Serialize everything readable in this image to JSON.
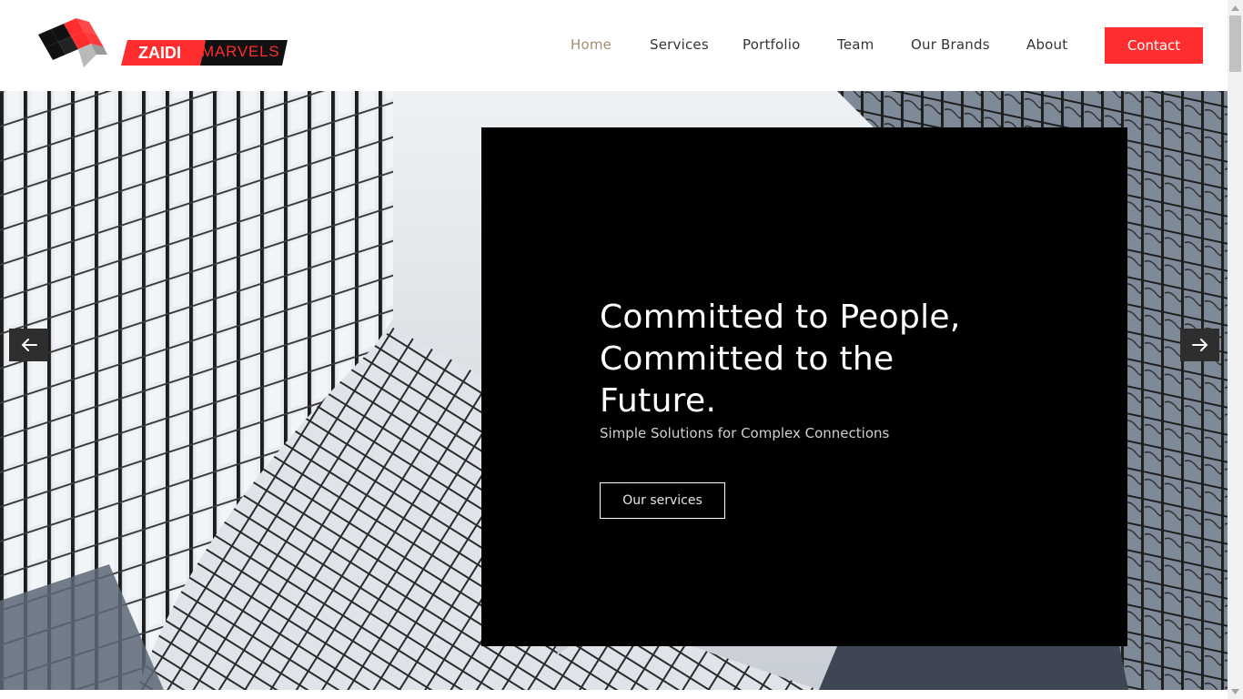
{
  "brand": {
    "name_part1": "ZAIDI",
    "name_part2": "MARVELS",
    "accent_color": "#ff2d2d"
  },
  "nav": {
    "items": [
      {
        "label": "Home",
        "active": true
      },
      {
        "label": "Services",
        "active": false
      },
      {
        "label": "Portfolio",
        "active": false
      },
      {
        "label": "Team",
        "active": false
      },
      {
        "label": "Our Brands",
        "active": false
      },
      {
        "label": "About",
        "active": false
      }
    ],
    "contact_label": "Contact"
  },
  "hero": {
    "headline": "Committed to People, Committed to the Future.",
    "subline": "Simple Solutions for Complex Connections",
    "button_label": "Our services",
    "prev_icon": "arrow-left-icon",
    "next_icon": "arrow-right-icon"
  }
}
